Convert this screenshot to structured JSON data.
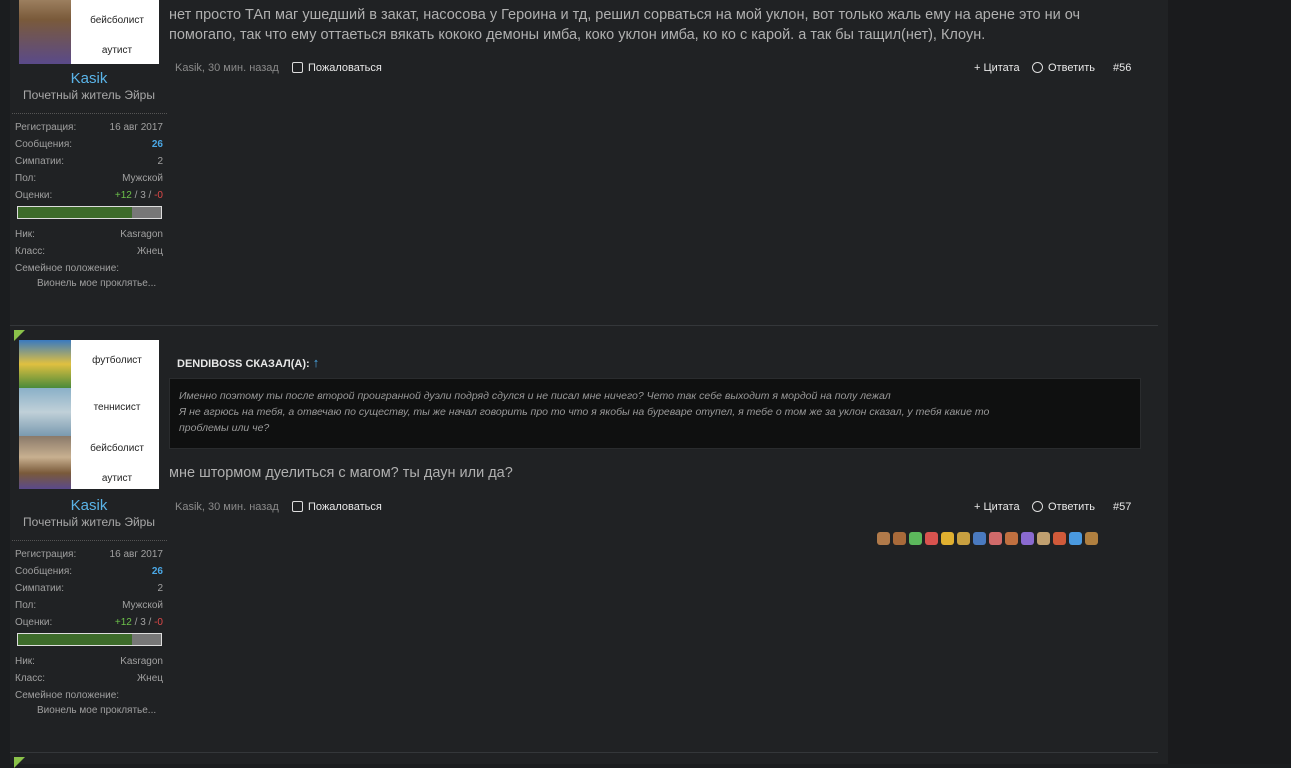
{
  "posts": [
    {
      "avatar_labels": [
        "бейсболист",
        "аутист"
      ],
      "username": "Kasik",
      "user_title": "Почетный житель Эйры",
      "stats": {
        "reg_label": "Регистрация:",
        "reg_value": "16 авг 2017",
        "msg_label": "Сообщения:",
        "msg_value": "26",
        "likes_label": "Симпатии:",
        "likes_value": "2",
        "gender_label": "Пол:",
        "gender_value": "Мужской",
        "rating_label": "Оценки:",
        "rating_pos": "+12",
        "rating_sep1": " / 3 / ",
        "rating_neg": "-0",
        "rating_fill": 0.8,
        "nick_label": "Ник:",
        "nick_value": "Kasragon",
        "class_label": "Класс:",
        "class_value": "Жнец",
        "family_label": "Семейное положение:",
        "family_value": "Вионель мое проклятье..."
      },
      "message_line1": "нет просто ТАп маг ушедший в закат, насосова у Героина и тд, решил сорваться на мой уклон, вот только жаль ему на арене это ни оч",
      "message_line2": "помогапо, так что ему оттаеться вякать кококо демоны имба, коко уклон имба, ко ко с карой. а так бы тащил(нет), Клоун.",
      "meta_author": "Kasik, 30 мин. назад",
      "report_label": "Пожаловаться",
      "quote_label": "+ Цитата",
      "reply_label": "Ответить",
      "post_number": "#56"
    },
    {
      "avatar_labels": [
        "футболист",
        "теннисист",
        "бейсболист",
        "аутист"
      ],
      "username": "Kasik",
      "user_title": "Почетный житель Эйры",
      "stats": {
        "reg_label": "Регистрация:",
        "reg_value": "16 авг 2017",
        "msg_label": "Сообщения:",
        "msg_value": "26",
        "likes_label": "Симпатии:",
        "likes_value": "2",
        "gender_label": "Пол:",
        "gender_value": "Мужской",
        "rating_label": "Оценки:",
        "rating_pos": "+12",
        "rating_sep1": " / 3 / ",
        "rating_neg": "-0",
        "rating_fill": 0.8,
        "nick_label": "Ник:",
        "nick_value": "Kasragon",
        "class_label": "Класс:",
        "class_value": "Жнец",
        "family_label": "Семейное положение:",
        "family_value": "Вионель мое проклятье..."
      },
      "quote_author": "DENDIBOSS СКАЗАЛ(А):",
      "quote_up": "↑",
      "quote_line1": "Именно поэтому ты после второй проигранной дуэли подряд сдулся и не писал мне ничего? Чето так себе выходит я мордой на полу лежал",
      "quote_line2": "Я не агрюсь на тебя, а отвечаю по существу, ты же начал говорить про то что я якобы на буреваре отупел, я тебе о том же за уклон сказал, у тебя какие то",
      "quote_line3": "проблемы или че?",
      "message": "мне штормом дуелиться с магом? ты даун или да?",
      "meta_author": "Kasik, 30 мин. назад",
      "report_label": "Пожаловаться",
      "quote_label": "+ Цитата",
      "reply_label": "Ответить",
      "post_number": "#57",
      "reactions": [
        "like-icon",
        "dislike-icon",
        "check-icon",
        "cross-icon",
        "grin-icon",
        "medal-icon",
        "info-icon",
        "heart-icon",
        "wrench-icon",
        "rainbow-icon",
        "brush-icon",
        "alarm-icon",
        "checkbox-icon",
        "wallet-icon"
      ],
      "reaction_colors": [
        "#b07a4a",
        "#a86a3a",
        "#5cb85c",
        "#d9534f",
        "#e0b030",
        "#c8a040",
        "#4a7ac0",
        "#d06a6a",
        "#c07040",
        "#8a6ad0",
        "#c0a070",
        "#d05a3a",
        "#4a9ae0",
        "#b08040"
      ]
    }
  ]
}
